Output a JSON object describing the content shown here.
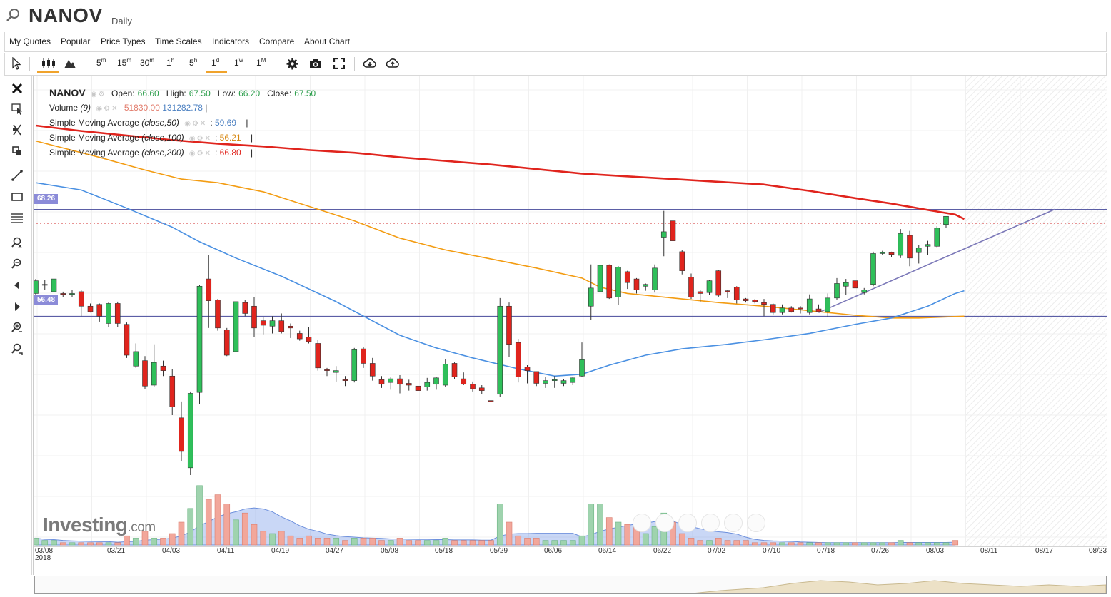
{
  "header": {
    "symbol": "NANOV",
    "period": "Daily"
  },
  "menu": [
    "My Quotes",
    "Popular",
    "Price Types",
    "Time Scales",
    "Indicators",
    "Compare",
    "About Chart"
  ],
  "toolbar": {
    "timeframes": [
      {
        "num": "5",
        "unit": "m"
      },
      {
        "num": "15",
        "unit": "m"
      },
      {
        "num": "30",
        "unit": "m"
      },
      {
        "num": "1",
        "unit": "h"
      },
      {
        "num": "5",
        "unit": "h"
      },
      {
        "num": "1",
        "unit": "d"
      },
      {
        "num": "1",
        "unit": "w"
      },
      {
        "num": "1",
        "unit": "M"
      }
    ],
    "active_timeframe": "1d"
  },
  "legend": {
    "symbol": "NANOV",
    "open_label": "Open:",
    "open": "66.60",
    "high_label": "High:",
    "high": "67.50",
    "low_label": "Low:",
    "low": "66.20",
    "close_label": "Close:",
    "close": "67.50",
    "volume_label": "Volume",
    "volume_param": "(9)",
    "volume_value": "51830.00",
    "volume_ma": "131282.78",
    "sma50_label": "Simple Moving Average",
    "sma50_param": "(close,50)",
    "sma50_value": "59.69",
    "sma100_label": "Simple Moving Average",
    "sma100_param": "(close,100)",
    "sma100_value": "56.21",
    "sma200_label": "Simple Moving Average",
    "sma200_param": "(close,200)",
    "sma200_value": "66.80"
  },
  "colors": {
    "up": "#2fbf5a",
    "down": "#e0241d",
    "sma50": "#4a90e2",
    "sma100": "#f39c12",
    "sma200": "#e0241d",
    "hline": "#5b5ea6",
    "tag": "#8b8bd8"
  },
  "price_tags": [
    "68.26",
    "56.48"
  ],
  "x_axis": [
    "03/08",
    "03/21",
    "04/03",
    "04/11",
    "04/19",
    "04/27",
    "05/08",
    "05/18",
    "05/29",
    "06/06",
    "06/14",
    "06/22",
    "07/02",
    "07/10",
    "07/18",
    "07/26",
    "08/03",
    "08/11",
    "08/17",
    "08/23"
  ],
  "x_axis_year": "2018",
  "logo": {
    "name": "Investing",
    "suffix": ".com"
  },
  "chart_data": {
    "type": "candlestick",
    "series": [
      {
        "o": 59.0,
        "h": 60.6,
        "l": 58.8,
        "c": 60.4
      },
      {
        "o": 60.0,
        "h": 60.5,
        "l": 59.4,
        "c": 60.0
      },
      {
        "o": 59.2,
        "h": 60.9,
        "l": 59.0,
        "c": 60.6
      },
      {
        "o": 59.0,
        "h": 59.2,
        "l": 58.6,
        "c": 58.9
      },
      {
        "o": 58.9,
        "h": 59.4,
        "l": 58.6,
        "c": 59.0
      },
      {
        "o": 59.2,
        "h": 59.4,
        "l": 56.5,
        "c": 57.6
      },
      {
        "o": 57.6,
        "h": 57.9,
        "l": 56.9,
        "c": 57.0
      },
      {
        "o": 57.8,
        "h": 57.9,
        "l": 55.9,
        "c": 56.5
      },
      {
        "o": 55.7,
        "h": 58.0,
        "l": 55.3,
        "c": 57.9
      },
      {
        "o": 57.9,
        "h": 58.1,
        "l": 55.3,
        "c": 55.7
      },
      {
        "o": 55.6,
        "h": 55.8,
        "l": 51.9,
        "c": 52.2
      },
      {
        "o": 51.0,
        "h": 53.5,
        "l": 50.8,
        "c": 52.6
      },
      {
        "o": 51.6,
        "h": 52.1,
        "l": 48.5,
        "c": 48.8
      },
      {
        "o": 48.9,
        "h": 53.4,
        "l": 48.7,
        "c": 51.4
      },
      {
        "o": 51.0,
        "h": 51.6,
        "l": 49.9,
        "c": 50.5
      },
      {
        "o": 49.9,
        "h": 50.7,
        "l": 45.6,
        "c": 46.5
      },
      {
        "o": 45.3,
        "h": 47.1,
        "l": 40.5,
        "c": 41.6
      },
      {
        "o": 39.8,
        "h": 48.2,
        "l": 39.0,
        "c": 48.0
      },
      {
        "o": 48.1,
        "h": 59.9,
        "l": 46.8,
        "c": 59.8
      },
      {
        "o": 60.6,
        "h": 63.2,
        "l": 55.2,
        "c": 58.2
      },
      {
        "o": 58.3,
        "h": 58.4,
        "l": 54.9,
        "c": 55.2
      },
      {
        "o": 55.0,
        "h": 55.2,
        "l": 52.1,
        "c": 52.2
      },
      {
        "o": 52.6,
        "h": 58.3,
        "l": 52.5,
        "c": 58.1
      },
      {
        "o": 58.0,
        "h": 58.3,
        "l": 56.5,
        "c": 56.8
      },
      {
        "o": 57.6,
        "h": 58.6,
        "l": 54.2,
        "c": 55.2
      },
      {
        "o": 56.0,
        "h": 56.4,
        "l": 54.5,
        "c": 55.5
      },
      {
        "o": 55.4,
        "h": 56.5,
        "l": 54.6,
        "c": 56.0
      },
      {
        "o": 56.0,
        "h": 56.8,
        "l": 54.6,
        "c": 54.8
      },
      {
        "o": 55.4,
        "h": 55.7,
        "l": 54.1,
        "c": 55.2
      },
      {
        "o": 54.6,
        "h": 54.9,
        "l": 53.8,
        "c": 54.0
      },
      {
        "o": 54.2,
        "h": 55.3,
        "l": 53.5,
        "c": 53.7
      },
      {
        "o": 53.5,
        "h": 53.9,
        "l": 50.5,
        "c": 50.8
      },
      {
        "o": 50.6,
        "h": 50.8,
        "l": 49.9,
        "c": 50.5
      },
      {
        "o": 50.3,
        "h": 51.0,
        "l": 49.3,
        "c": 50.5
      },
      {
        "o": 49.5,
        "h": 49.9,
        "l": 48.8,
        "c": 49.4
      },
      {
        "o": 49.4,
        "h": 53.0,
        "l": 49.2,
        "c": 52.8
      },
      {
        "o": 52.9,
        "h": 53.1,
        "l": 50.8,
        "c": 51.3
      },
      {
        "o": 51.3,
        "h": 51.9,
        "l": 49.4,
        "c": 49.9
      },
      {
        "o": 49.5,
        "h": 49.9,
        "l": 48.6,
        "c": 49.0
      },
      {
        "o": 49.2,
        "h": 49.8,
        "l": 48.4,
        "c": 49.6
      },
      {
        "o": 49.6,
        "h": 50.0,
        "l": 48.0,
        "c": 49.0
      },
      {
        "o": 49.1,
        "h": 49.5,
        "l": 48.3,
        "c": 48.9
      },
      {
        "o": 48.8,
        "h": 49.4,
        "l": 47.9,
        "c": 48.3
      },
      {
        "o": 48.7,
        "h": 49.7,
        "l": 48.3,
        "c": 49.2
      },
      {
        "o": 49.0,
        "h": 49.8,
        "l": 48.4,
        "c": 49.7
      },
      {
        "o": 48.9,
        "h": 51.8,
        "l": 48.7,
        "c": 51.2
      },
      {
        "o": 51.3,
        "h": 51.4,
        "l": 49.6,
        "c": 49.8
      },
      {
        "o": 49.6,
        "h": 50.3,
        "l": 48.9,
        "c": 49.0
      },
      {
        "o": 49.0,
        "h": 49.3,
        "l": 48.2,
        "c": 48.5
      },
      {
        "o": 48.6,
        "h": 48.9,
        "l": 47.9,
        "c": 48.3
      },
      {
        "o": 47.2,
        "h": 47.4,
        "l": 46.2,
        "c": 47.1
      },
      {
        "o": 47.9,
        "h": 58.5,
        "l": 47.6,
        "c": 57.6
      },
      {
        "o": 57.6,
        "h": 58.0,
        "l": 52.0,
        "c": 53.4
      },
      {
        "o": 53.6,
        "h": 54.0,
        "l": 49.2,
        "c": 49.8
      },
      {
        "o": 50.9,
        "h": 51.1,
        "l": 49.1,
        "c": 50.5
      },
      {
        "o": 50.4,
        "h": 50.4,
        "l": 48.8,
        "c": 49.1
      },
      {
        "o": 49.1,
        "h": 49.8,
        "l": 48.6,
        "c": 49.4
      },
      {
        "o": 49.4,
        "h": 49.9,
        "l": 48.6,
        "c": 49.5
      },
      {
        "o": 49.1,
        "h": 49.6,
        "l": 48.8,
        "c": 49.4
      },
      {
        "o": 49.2,
        "h": 49.8,
        "l": 48.9,
        "c": 49.7
      },
      {
        "o": 49.9,
        "h": 53.6,
        "l": 49.8,
        "c": 51.7
      },
      {
        "o": 57.6,
        "h": 62.2,
        "l": 56.1,
        "c": 59.6
      },
      {
        "o": 59.2,
        "h": 62.4,
        "l": 56.1,
        "c": 62.1
      },
      {
        "o": 62.1,
        "h": 62.2,
        "l": 58.4,
        "c": 58.5
      },
      {
        "o": 58.6,
        "h": 62.0,
        "l": 57.7,
        "c": 61.9
      },
      {
        "o": 61.4,
        "h": 61.5,
        "l": 59.5,
        "c": 60.2
      },
      {
        "o": 60.6,
        "h": 60.7,
        "l": 59.0,
        "c": 59.4
      },
      {
        "o": 59.8,
        "h": 60.1,
        "l": 59.3,
        "c": 60.0
      },
      {
        "o": 59.4,
        "h": 62.2,
        "l": 59.1,
        "c": 61.8
      },
      {
        "o": 65.2,
        "h": 68.1,
        "l": 63.1,
        "c": 65.8
      },
      {
        "o": 67.0,
        "h": 67.6,
        "l": 64.3,
        "c": 64.8
      },
      {
        "o": 63.6,
        "h": 63.8,
        "l": 61.1,
        "c": 61.5
      },
      {
        "o": 60.8,
        "h": 61.2,
        "l": 58.4,
        "c": 58.6
      },
      {
        "o": 59.2,
        "h": 59.4,
        "l": 58.1,
        "c": 59.0
      },
      {
        "o": 59.1,
        "h": 60.5,
        "l": 58.8,
        "c": 60.4
      },
      {
        "o": 61.5,
        "h": 61.6,
        "l": 58.6,
        "c": 58.8
      },
      {
        "o": 59.3,
        "h": 59.4,
        "l": 58.5,
        "c": 59.2
      },
      {
        "o": 59.7,
        "h": 59.8,
        "l": 57.9,
        "c": 58.3
      },
      {
        "o": 58.4,
        "h": 58.5,
        "l": 58.0,
        "c": 58.2
      },
      {
        "o": 58.3,
        "h": 58.4,
        "l": 57.9,
        "c": 58.1
      },
      {
        "o": 58.0,
        "h": 58.4,
        "l": 56.5,
        "c": 57.8
      },
      {
        "o": 57.8,
        "h": 57.9,
        "l": 56.7,
        "c": 56.9
      },
      {
        "o": 56.9,
        "h": 57.8,
        "l": 56.7,
        "c": 57.4
      },
      {
        "o": 57.4,
        "h": 57.6,
        "l": 56.9,
        "c": 57.0
      },
      {
        "o": 57.4,
        "h": 57.6,
        "l": 56.8,
        "c": 57.3
      },
      {
        "o": 56.9,
        "h": 58.9,
        "l": 56.7,
        "c": 58.4
      },
      {
        "o": 57.3,
        "h": 57.8,
        "l": 56.9,
        "c": 57.0
      },
      {
        "o": 57.0,
        "h": 59.0,
        "l": 56.4,
        "c": 58.5
      },
      {
        "o": 58.5,
        "h": 60.7,
        "l": 58.3,
        "c": 60.1
      },
      {
        "o": 59.8,
        "h": 60.6,
        "l": 58.8,
        "c": 60.2
      },
      {
        "o": 60.4,
        "h": 60.4,
        "l": 59.3,
        "c": 59.6
      },
      {
        "o": 59.1,
        "h": 59.6,
        "l": 58.9,
        "c": 59.4
      },
      {
        "o": 60.0,
        "h": 63.6,
        "l": 59.8,
        "c": 63.4
      },
      {
        "o": 63.4,
        "h": 63.7,
        "l": 63.2,
        "c": 63.5
      },
      {
        "o": 63.5,
        "h": 63.6,
        "l": 63.0,
        "c": 63.3
      },
      {
        "o": 63.2,
        "h": 66.1,
        "l": 62.9,
        "c": 65.6
      },
      {
        "o": 65.4,
        "h": 65.9,
        "l": 62.0,
        "c": 62.9
      },
      {
        "o": 63.5,
        "h": 64.3,
        "l": 62.3,
        "c": 64.0
      },
      {
        "o": 64.2,
        "h": 64.8,
        "l": 63.2,
        "c": 64.4
      },
      {
        "o": 64.2,
        "h": 66.4,
        "l": 64.1,
        "c": 66.2
      },
      {
        "o": 66.6,
        "h": 67.5,
        "l": 66.2,
        "c": 67.5
      }
    ],
    "sma50": [
      [
        0,
        71.2
      ],
      [
        5,
        70.4
      ],
      [
        10,
        68.4
      ],
      [
        15,
        66.3
      ],
      [
        18,
        64.7
      ],
      [
        20,
        63.8
      ],
      [
        22,
        62.9
      ],
      [
        27,
        60.9
      ],
      [
        33,
        58.1
      ],
      [
        40,
        54.4
      ],
      [
        44,
        53.0
      ],
      [
        48,
        51.9
      ],
      [
        53,
        50.7
      ],
      [
        57,
        49.9
      ],
      [
        60,
        50.1
      ],
      [
        63,
        51.1
      ],
      [
        67,
        52.2
      ],
      [
        71,
        52.9
      ],
      [
        76,
        53.4
      ],
      [
        80,
        53.9
      ],
      [
        85,
        54.6
      ],
      [
        90,
        55.6
      ],
      [
        94,
        56.3
      ],
      [
        98,
        57.6
      ],
      [
        101,
        59.0
      ],
      [
        102,
        59.3
      ]
    ],
    "sma100": [
      [
        0,
        75.8
      ],
      [
        7,
        74.0
      ],
      [
        12,
        72.6
      ],
      [
        16,
        71.6
      ],
      [
        20,
        71.2
      ],
      [
        25,
        70.2
      ],
      [
        30,
        68.6
      ],
      [
        35,
        67.0
      ],
      [
        40,
        65.1
      ],
      [
        45,
        63.8
      ],
      [
        50,
        62.8
      ],
      [
        55,
        61.8
      ],
      [
        60,
        60.7
      ],
      [
        62,
        59.7
      ],
      [
        65,
        59.0
      ],
      [
        70,
        58.5
      ],
      [
        75,
        58.0
      ],
      [
        80,
        57.6
      ],
      [
        85,
        57.1
      ],
      [
        90,
        56.6
      ],
      [
        94,
        56.3
      ],
      [
        97,
        56.3
      ],
      [
        102,
        56.5
      ]
    ],
    "sma200": [
      [
        0,
        77.5
      ],
      [
        5,
        76.9
      ],
      [
        10,
        76.4
      ],
      [
        15,
        75.9
      ],
      [
        20,
        75.5
      ],
      [
        25,
        75.2
      ],
      [
        30,
        74.8
      ],
      [
        35,
        74.5
      ],
      [
        40,
        74.0
      ],
      [
        45,
        73.6
      ],
      [
        50,
        73.2
      ],
      [
        55,
        72.7
      ],
      [
        60,
        72.2
      ],
      [
        65,
        71.9
      ],
      [
        70,
        71.6
      ],
      [
        75,
        71.3
      ],
      [
        80,
        71.0
      ],
      [
        85,
        70.3
      ],
      [
        90,
        69.5
      ],
      [
        94,
        68.9
      ],
      [
        98,
        68.2
      ],
      [
        101,
        67.7
      ],
      [
        102,
        67.2
      ]
    ],
    "volume": [
      3,
      2,
      2,
      1,
      1,
      1,
      1,
      1,
      1,
      1,
      4,
      3,
      6,
      3,
      3,
      5,
      10,
      16,
      26,
      20,
      22,
      18,
      11,
      14,
      9,
      6,
      5,
      6,
      4,
      3,
      4,
      3,
      3,
      3,
      2,
      3,
      3,
      3,
      2,
      2,
      3,
      2,
      2,
      2,
      2,
      3,
      2,
      2,
      2,
      2,
      2,
      18,
      10,
      4,
      3,
      3,
      2,
      2,
      2,
      2,
      4,
      18,
      18,
      12,
      10,
      9,
      8,
      5,
      8,
      14,
      10,
      5,
      3,
      2,
      2,
      3,
      2,
      2,
      2,
      1,
      1,
      1,
      1,
      1,
      1,
      1,
      1,
      1,
      1,
      1,
      1,
      1,
      1,
      1,
      1,
      2,
      1,
      1,
      1,
      1,
      1,
      2
    ],
    "horizontal_lines": [
      68.26,
      56.48
    ],
    "trendline": [
      [
        86,
        56.9
      ],
      [
        112,
        68.3
      ]
    ],
    "ylim": [
      39,
      83
    ]
  }
}
